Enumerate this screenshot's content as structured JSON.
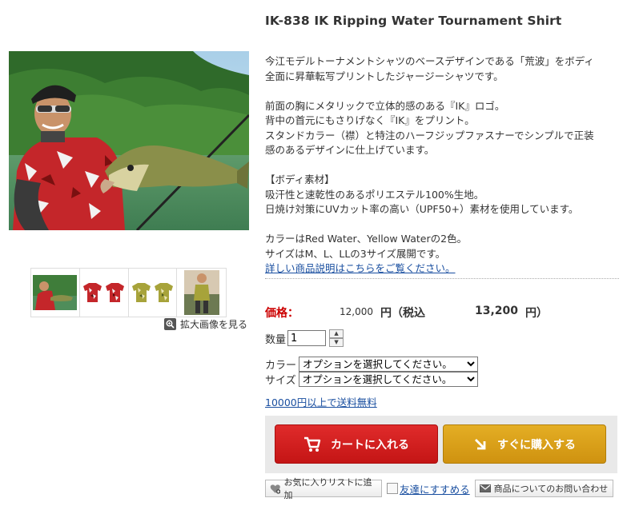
{
  "product": {
    "title": "IK-838 IK Ripping Water Tournament Shirt"
  },
  "description": {
    "lines": [
      "今江モデルトーナメントシャツのベースデザインである「荒波」をボディ",
      "全面に昇華転写プリントしたジャージーシャツです。",
      "",
      "前面の胸にメタリックで立体的感のある『IK』ロゴ。",
      "背中の首元にもさりげなく『IK』をプリント。",
      "スタンドカラー（襟）と特注のハーフジップファスナーでシンプルで正装",
      "感のあるデザインに仕上げています。",
      "",
      "【ボディ素材】",
      "吸汗性と速乾性のあるポリエステル100%生地。",
      "日焼け対策にUVカット率の高い（UPF50+）素材を使用しています。",
      "",
      "カラーはRed Water、Yellow Waterの2色。",
      "サイズはM、L、LLの3サイズ展開です。"
    ],
    "detail_link": "詳しい商品説明はこちらをご覧ください。"
  },
  "gallery": {
    "zoom_label": "拡大画像を見る",
    "thumbnails": [
      "angler-photo-thumb",
      "red-shirt-thumb",
      "yellow-shirt-thumb",
      "angler-fullbody-thumb"
    ]
  },
  "price": {
    "label": "価格：",
    "value": "12,000",
    "yen": "円（税込",
    "tax_value": "13,200",
    "tax_yen": "円）"
  },
  "quantity": {
    "label": "数量",
    "value": "1"
  },
  "options": {
    "color_label": "カラー",
    "size_label": "サイズ",
    "placeholder": "オプションを選択してください。"
  },
  "shipping_link": "10000円以上で送料無料",
  "buttons": {
    "cart": "カートに入れる",
    "buy_now": "すぐに購入する",
    "favorite": "お気に入りリストに追加",
    "recommend": "友達にすすめる",
    "inquiry": "商品についてのお問い合わせ"
  },
  "colors": {
    "price_red": "#cc0000",
    "cart_red": "#d42020",
    "buy_gold": "#dba21a",
    "link_blue": "#1a4fa0"
  }
}
